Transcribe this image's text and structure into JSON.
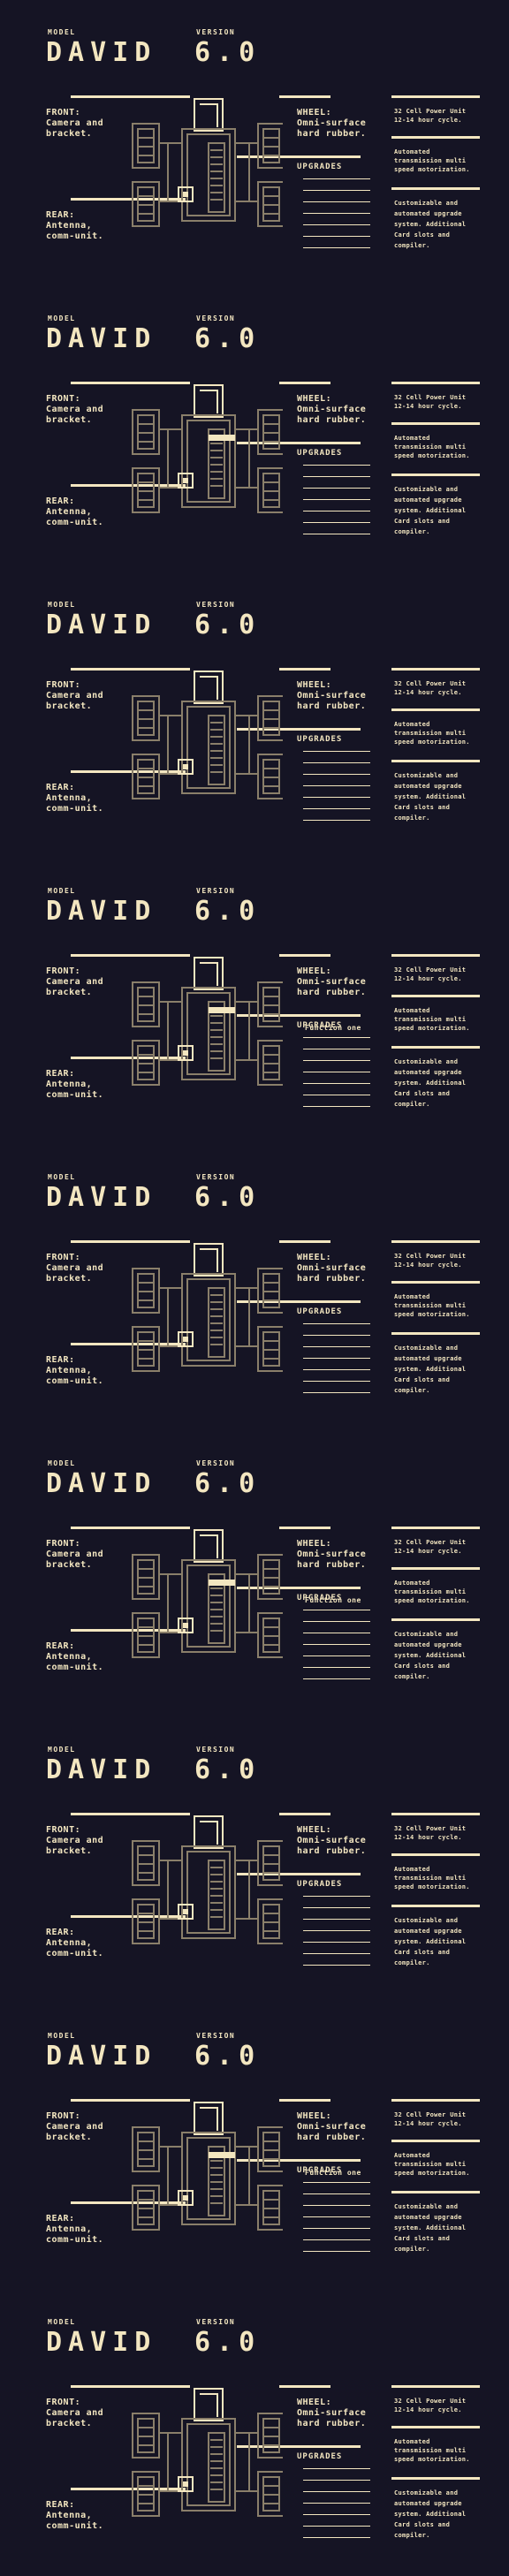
{
  "labels": {
    "model": "MODEL",
    "version": "VERSION",
    "name": "DAVID",
    "version_number": "6.0",
    "front_head": "FRONT:",
    "front_body_1": "Camera and",
    "front_body_2": "bracket.",
    "rear_head": "REAR:",
    "rear_body_1": "Antenna,",
    "rear_body_2": "comm-unit.",
    "wheel_head": "WHEEL:",
    "wheel_body_1": "Omni-surface",
    "wheel_body_2": "hard rubber.",
    "upgrades": "UPGRADES",
    "spec_1a": "32 Cell Power Unit",
    "spec_1b": "12-14 hour cycle.",
    "spec_2a": "Automated",
    "spec_2b": "transmission multi",
    "spec_2c": "speed motorization.",
    "spec_3a": "Customizable and",
    "spec_3b": "automated upgrade",
    "spec_3c": "system. Additional",
    "spec_3d": "Card slots and",
    "spec_3e": "compiler."
  },
  "frames": [
    {
      "highlight": false,
      "function_label": ""
    },
    {
      "highlight": true,
      "function_label": ""
    },
    {
      "highlight": false,
      "function_label": ""
    },
    {
      "highlight": true,
      "function_label": "Function one"
    },
    {
      "highlight": false,
      "function_label": ""
    },
    {
      "highlight": true,
      "function_label": "Function one"
    },
    {
      "highlight": false,
      "function_label": ""
    },
    {
      "highlight": true,
      "function_label": "Function one"
    },
    {
      "highlight": false,
      "function_label": ""
    }
  ],
  "colors": {
    "background": "#151424",
    "accent": "#f3e6c0",
    "robot_stroke": "#8a7f6a"
  }
}
